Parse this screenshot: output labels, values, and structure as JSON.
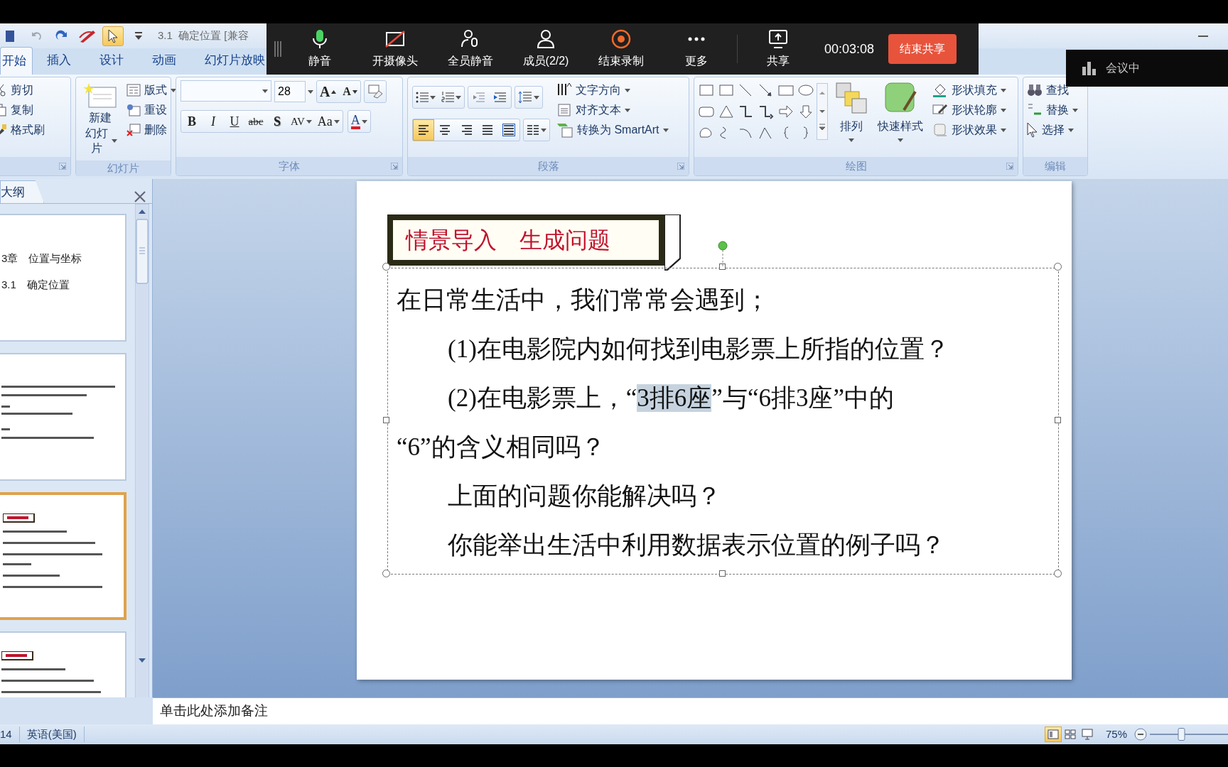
{
  "title_bar": {
    "title": "3.1  确定位置 [兼容"
  },
  "ribbon_tabs": [
    {
      "label": "开始",
      "selected": true
    },
    {
      "label": "插入",
      "selected": false
    },
    {
      "label": "设计",
      "selected": false
    },
    {
      "label": "动画",
      "selected": false
    },
    {
      "label": "幻灯片放映",
      "selected": false
    }
  ],
  "ribbon": {
    "clipboard": {
      "items": [
        "剪切",
        "复制",
        "格式刷"
      ]
    },
    "slides": {
      "label": "幻灯片",
      "new_slide": [
        "新建",
        "幻灯片"
      ],
      "items": [
        "版式",
        "重设",
        "删除"
      ]
    },
    "font": {
      "label": "字体",
      "font_size": "28",
      "size_buttons": [
        "A",
        "A"
      ],
      "format_buttons": [
        {
          "label": "B",
          "kind": "bold"
        },
        {
          "label": "I",
          "kind": "italic"
        },
        {
          "label": "U",
          "kind": "underline"
        },
        {
          "label": "abc",
          "kind": "strike"
        },
        {
          "label": "S",
          "kind": "shadow"
        },
        {
          "label": "AV",
          "kind": "spacing"
        },
        {
          "label": "Aa",
          "kind": "case"
        },
        {
          "label": "A",
          "kind": "color"
        }
      ]
    },
    "paragraph": {
      "label": "段落",
      "items": [
        "文字方向",
        "对齐文本",
        "转换为 SmartArt"
      ],
      "alignment": [
        {
          "kind": "left",
          "selected": true
        },
        {
          "kind": "center",
          "selected": false
        },
        {
          "kind": "right",
          "selected": false
        },
        {
          "kind": "justify",
          "selected": false
        },
        {
          "kind": "distributed",
          "selected": false
        }
      ]
    },
    "drawing": {
      "label": "绘图",
      "big_buttons": [
        "排列",
        "快速样式"
      ],
      "items": [
        "形状填充",
        "形状轮廓",
        "形状效果"
      ]
    },
    "editing": {
      "label": "编辑",
      "items": [
        "查找",
        "替换",
        "选择"
      ]
    }
  },
  "meeting_toolbar": {
    "buttons": [
      {
        "label": "静音",
        "kind": "mic"
      },
      {
        "label": "开摄像头",
        "kind": "camera"
      },
      {
        "label": "全员静音",
        "kind": "mute_all"
      },
      {
        "label": "成员(2/2)",
        "kind": "members"
      },
      {
        "label": "结束录制",
        "kind": "record"
      },
      {
        "label": "更多",
        "kind": "more"
      },
      {
        "label": "共享",
        "kind": "share"
      }
    ],
    "timer": "00:03:08",
    "end_share": "结束共享"
  },
  "meeting_status": "会议中",
  "outline_panel": {
    "tab": "大纲",
    "slides": [
      {
        "kind": "title",
        "selected": false,
        "lines": [
          "3章　位置与坐标",
          "3.1　确定位置"
        ]
      },
      {
        "kind": "text",
        "selected": false
      },
      {
        "kind": "banner",
        "selected": true
      },
      {
        "kind": "banner",
        "selected": false
      }
    ]
  },
  "slide": {
    "title": "情景导入　生成问题",
    "lines": [
      {
        "kind": "lead",
        "segments": [
          {
            "text": "在日常生活中，我们常常会遇到；",
            "selected": false
          }
        ]
      },
      {
        "kind": "indented",
        "segments": [
          {
            "text": "(1)在电影院内如何找到电影票上所指的位置？",
            "selected": false
          }
        ]
      },
      {
        "kind": "indented",
        "segments": [
          {
            "text": "(2)在电影票上，“",
            "selected": false
          },
          {
            "text": "3排6座",
            "selected": true
          },
          {
            "text": "”与“6排3座”中的",
            "selected": false
          }
        ]
      },
      {
        "kind": "lead",
        "segments": [
          {
            "text": "“6”的含义相同吗？",
            "selected": false
          }
        ]
      },
      {
        "kind": "indented",
        "segments": [
          {
            "text": "上面的问题你能解决吗？",
            "selected": false
          }
        ]
      },
      {
        "kind": "indented",
        "segments": [
          {
            "text": "你能举出生活中利用数据表示位置的例子吗？",
            "selected": false
          }
        ]
      }
    ]
  },
  "notes": {
    "placeholder": "单击此处添加备注"
  },
  "status_bar": {
    "slide_count": "14",
    "language": "英语(美国)",
    "views": [
      {
        "kind": "normal",
        "selected": true
      },
      {
        "kind": "sorter",
        "selected": false
      },
      {
        "kind": "show",
        "selected": false
      }
    ],
    "zoom": "75%"
  }
}
